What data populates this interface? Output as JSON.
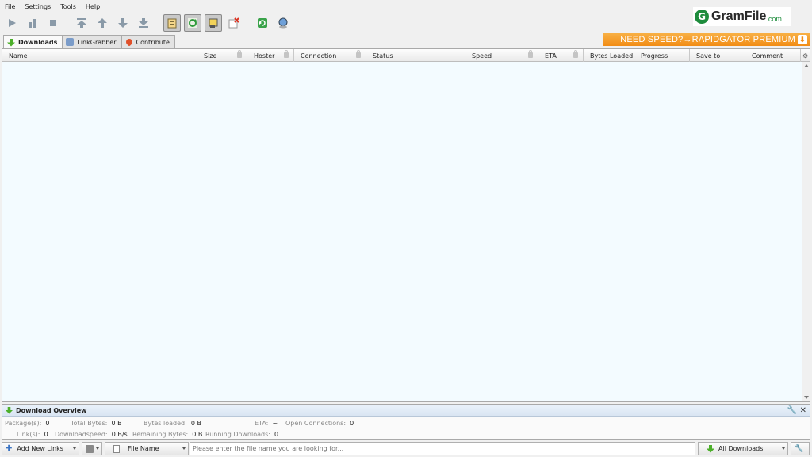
{
  "menu": [
    "File",
    "Settings",
    "Tools",
    "Help"
  ],
  "logo": {
    "brand": "GramFile",
    "tld": ".com",
    "glyph": "G"
  },
  "toolbar": {
    "icons": [
      "play-icon",
      "pause-icon",
      "stop-icon",
      "move-top-icon",
      "move-up-icon",
      "move-down-icon",
      "move-bottom-icon",
      "clipboard-observer-icon",
      "auto-reconnect-icon",
      "premium-toggle-icon",
      "clear-icon",
      "reconnect-icon",
      "update-icon"
    ]
  },
  "tabs": [
    {
      "label": "Downloads",
      "active": true
    },
    {
      "label": "LinkGrabber",
      "active": false
    },
    {
      "label": "Contribute",
      "active": false
    }
  ],
  "banner": {
    "text": "NEED SPEED?→RAPIDGATOR PREMIUM"
  },
  "columns": [
    "Name",
    "Size",
    "Hoster",
    "Connection",
    "Status",
    "Speed",
    "ETA",
    "Bytes Loaded",
    "Progress",
    "Save to",
    "Comment"
  ],
  "overview": {
    "title": "Download Overview",
    "packages_label": "Package(s):",
    "packages": "0",
    "total_bytes_label": "Total Bytes:",
    "total_bytes": "0 B",
    "bytes_loaded_label": "Bytes loaded:",
    "bytes_loaded": "0 B",
    "eta_label": "ETA:",
    "eta": "~",
    "open_conn_label": "Open Connections:",
    "open_conn": "0",
    "links_label": "Link(s):",
    "links": "0",
    "dlspeed_label": "Downloadspeed:",
    "dlspeed": "0 B/s",
    "remaining_label": "Remaining Bytes:",
    "remaining": "0 B",
    "running_label": "Running Downloads:",
    "running": "0"
  },
  "bottom": {
    "add_links": "Add New Links",
    "file_name": "File Name",
    "search_placeholder": "Please enter the file name you are looking for...",
    "filter": "All Downloads"
  },
  "colors": {
    "accent_green": "#4caf2a",
    "banner_orange": "#f28c14",
    "table_bg": "#f3fbff"
  }
}
